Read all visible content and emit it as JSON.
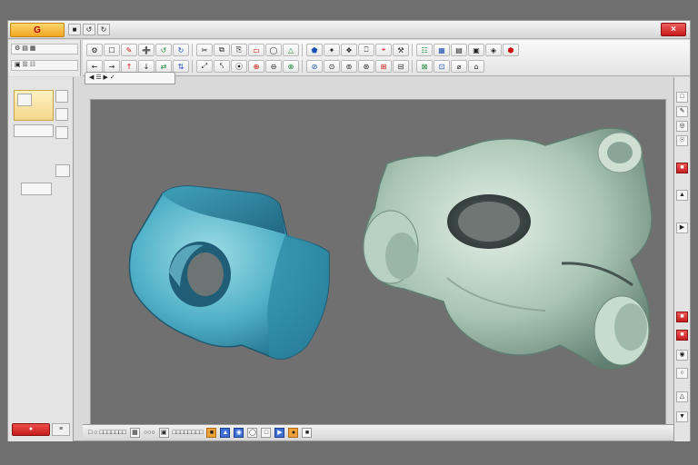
{
  "window": {
    "app_badge": "G",
    "close_label": "×"
  },
  "toolbar": {
    "row1": [
      "⚙",
      "☐",
      "✎",
      "➕",
      "↺",
      "↻",
      "✂",
      "⧉",
      "⎘",
      "▭",
      "◯",
      "△",
      "⬟",
      "✦",
      "❖",
      "⎕",
      "⌖",
      "⚒",
      "☷",
      "▦",
      "▤",
      "▣",
      "◈",
      "⬢"
    ],
    "row2": [
      "←",
      "→",
      "↑",
      "↓",
      "⇄",
      "⇅",
      "⤢",
      "⤣",
      "⦿",
      "⊕",
      "⊖",
      "⊗",
      "⊘",
      "⊙",
      "⊚",
      "⊛",
      "⊞",
      "⊟",
      "⊠",
      "⊡",
      "⌀",
      "⌂"
    ]
  },
  "left_ribbon": {
    "btn1": "⚙ ▤ ▦",
    "btn2": "▣ ☰ ☷"
  },
  "document_tab": {
    "label": "◀ ☰ ▶ ✓"
  },
  "left_panel": {
    "status_label": "●",
    "status2_label": "≡"
  },
  "statusbar": {
    "text1": "□ ○ □□□□□□□",
    "text2": "○○○",
    "text3": "□□□□□□□□"
  },
  "colors": {
    "part_left": "#48a9c4",
    "part_right": "#a9c5b4",
    "viewport_bg": "#707070",
    "accent_red": "#c61b1b"
  },
  "icons": {
    "close": "close-icon",
    "part_left": "3d-bracket-part",
    "part_right": "3d-housing-part"
  }
}
